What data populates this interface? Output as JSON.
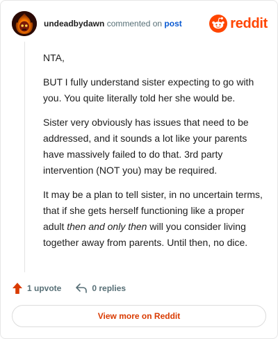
{
  "header": {
    "username": "undeadbydawn",
    "verb": "commented on",
    "post_link": "post",
    "brand": "reddit"
  },
  "comment": {
    "paragraphs": [
      {
        "segments": [
          {
            "text": "NTA,"
          }
        ]
      },
      {
        "segments": [
          {
            "text": "BUT I fully understand sister expecting to go with you. You quite literally told her she would be."
          }
        ]
      },
      {
        "segments": [
          {
            "text": "Sister very obviously has issues that need to be addressed, and it sounds a lot like your parents have massively failed to do that. 3rd party intervention (NOT you) may be required."
          }
        ]
      },
      {
        "segments": [
          {
            "text": "It may be a plan to tell sister, in no uncertain terms, that if she gets herself functioning like a proper adult "
          },
          {
            "text": "then and only then",
            "italic": true
          },
          {
            "text": " will you consider living together away from parents. Until then, no dice."
          }
        ]
      }
    ]
  },
  "footer": {
    "upvotes": "1 upvote",
    "replies": "0 replies",
    "view_more": "View more on Reddit"
  },
  "colors": {
    "brand": "#ff4500",
    "link": "#0a5ad2",
    "upvote": "#d93a00"
  },
  "icons": {
    "avatar": "flaming-skull-avatar",
    "logo": "reddit-snoo-icon",
    "upvote": "upvote-arrow-icon",
    "reply": "reply-arrow-icon"
  }
}
